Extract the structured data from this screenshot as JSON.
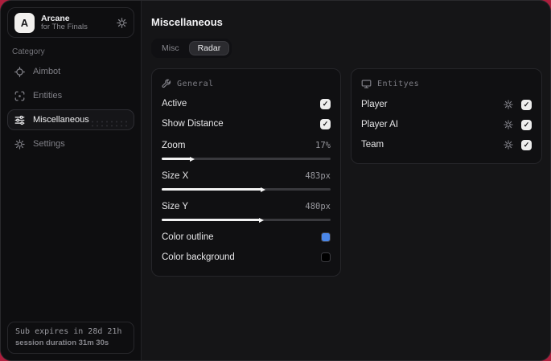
{
  "sidebar": {
    "logo_letter": "A",
    "app_name": "Arcane",
    "app_subtitle": "for The Finals",
    "category_label": "Category",
    "items": [
      {
        "label": "Aimbot",
        "icon": "crosshair-icon",
        "active": false
      },
      {
        "label": "Entities",
        "icon": "scan-icon",
        "active": false
      },
      {
        "label": "Miscellaneous",
        "icon": "sliders-icon",
        "active": true
      },
      {
        "label": "Settings",
        "icon": "gear-icon",
        "active": false
      }
    ],
    "footer": {
      "sub_line": "Sub expires in 28d 21h",
      "session_line": "session duration 31m 30s"
    }
  },
  "main": {
    "title": "Miscellaneous",
    "tabs": [
      {
        "label": "Misc",
        "active": false
      },
      {
        "label": "Radar",
        "active": true
      }
    ]
  },
  "general_panel": {
    "title": "General",
    "icon": "wrench-icon",
    "toggles": [
      {
        "label": "Active",
        "checked": true
      },
      {
        "label": "Show Distance",
        "checked": true
      }
    ],
    "sliders": [
      {
        "label": "Zoom",
        "value": "17%",
        "percent": 17
      },
      {
        "label": "Size X",
        "value": "483px",
        "percent": 59
      },
      {
        "label": "Size Y",
        "value": "480px",
        "percent": 58
      }
    ],
    "colors": [
      {
        "label": "Color outline",
        "swatch": "#4b87e8"
      },
      {
        "label": "Color background",
        "swatch": "#000000"
      }
    ]
  },
  "entities_panel": {
    "title": "Entityes",
    "icon": "monitor-icon",
    "rows": [
      {
        "label": "Player",
        "checked": true
      },
      {
        "label": "Player AI",
        "checked": true
      },
      {
        "label": "Team",
        "checked": true
      }
    ]
  },
  "colors": {
    "page_accent": "#ad1e3d",
    "outline_swatch": "#4b87e8",
    "background_swatch": "#000000"
  }
}
